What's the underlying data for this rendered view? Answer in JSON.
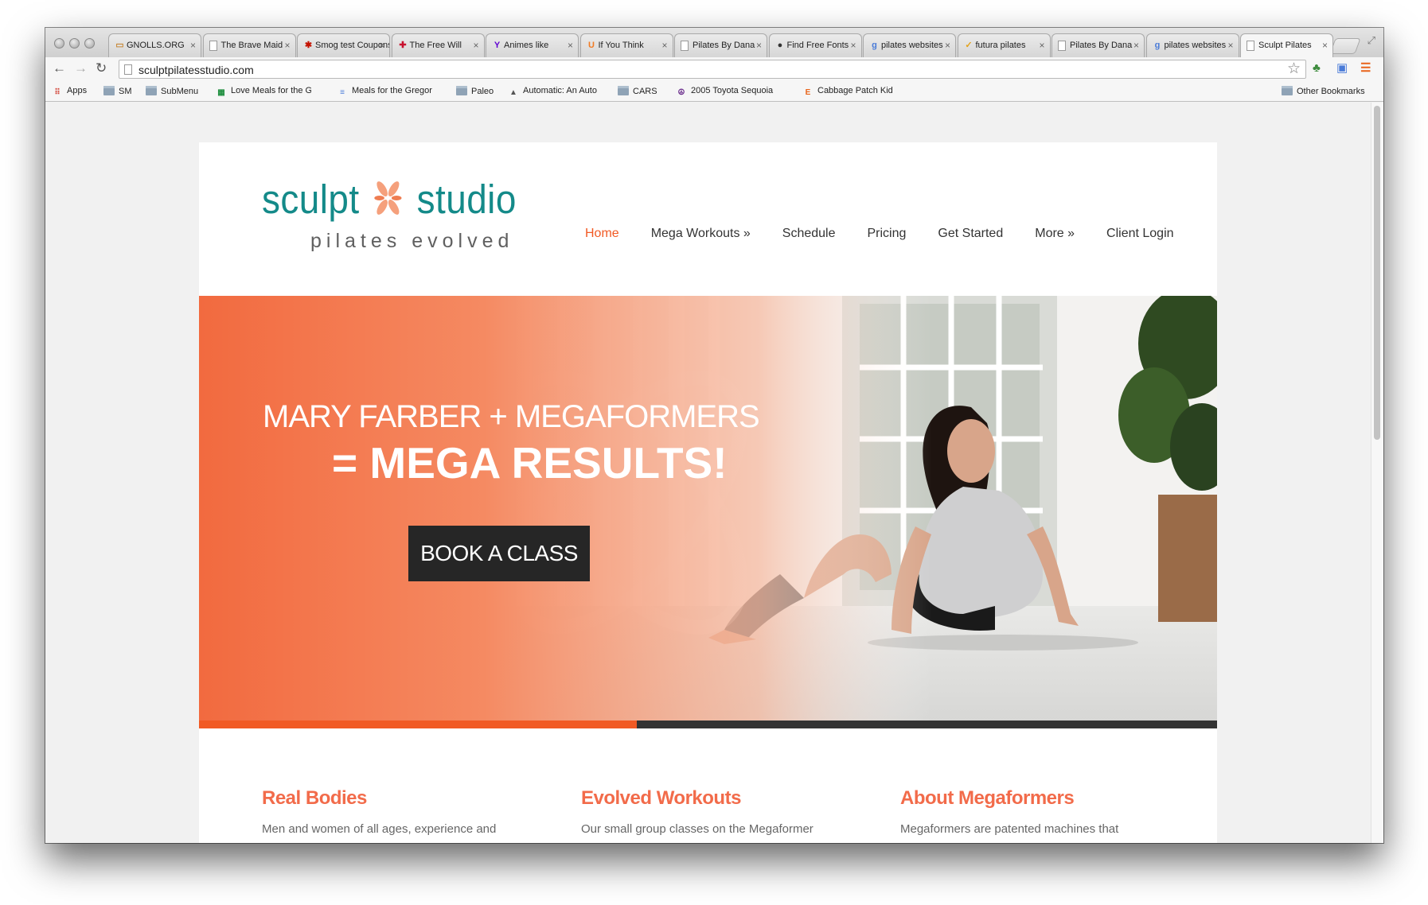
{
  "browser": {
    "tabs": [
      {
        "title": "GNOLLS.ORG",
        "icon": "gnolls-icon",
        "color": "#c78a3b"
      },
      {
        "title": "The Brave Maid",
        "icon": "page-icon",
        "color": "#888888"
      },
      {
        "title": "Smog test Coupons",
        "icon": "yelp-icon",
        "color": "#c41200"
      },
      {
        "title": "The Free Will",
        "icon": "flag-icon",
        "color": "#c8102e"
      },
      {
        "title": "Animes like",
        "icon": "yahoo-icon",
        "color": "#5f01d1"
      },
      {
        "title": "If You Think",
        "icon": "up-icon",
        "color": "#f27a22"
      },
      {
        "title": "Pilates By Dana",
        "icon": "page-icon",
        "color": "#888888"
      },
      {
        "title": "Find Free Fonts",
        "icon": "font-icon",
        "color": "#333333"
      },
      {
        "title": "pilates websites",
        "icon": "google-icon",
        "color": "#4a7bd8"
      },
      {
        "title": "futura pilates",
        "icon": "check-icon",
        "color": "#e3a21a"
      },
      {
        "title": "Pilates By Dana",
        "icon": "page-icon",
        "color": "#888888"
      },
      {
        "title": "pilates websites",
        "icon": "google-icon",
        "color": "#4a7bd8"
      },
      {
        "title": "Sculpt Pilates",
        "icon": "page-icon",
        "color": "#888888"
      }
    ],
    "url": "sculptpilatesstudio.com",
    "bookmarks": [
      {
        "label": "Apps",
        "icon": "apps-grid-icon"
      },
      {
        "label": "SM",
        "icon": "folder-icon"
      },
      {
        "label": "SubMenu",
        "icon": "folder-icon"
      },
      {
        "label": "Love Meals for the Gregory",
        "icon": "sheets-icon"
      },
      {
        "label": "Meals for the Gregory",
        "icon": "docs-icon"
      },
      {
        "label": "Paleo",
        "icon": "folder-icon"
      },
      {
        "label": "Automatic: An Auto",
        "icon": "automatic-icon"
      },
      {
        "label": "CARS",
        "icon": "folder-icon"
      },
      {
        "label": "2005 Toyota Sequoia",
        "icon": "peace-icon"
      },
      {
        "label": "Cabbage Patch Kid",
        "icon": "etsy-icon"
      }
    ],
    "other_bookmarks": "Other Bookmarks"
  },
  "site": {
    "logo": {
      "left": "sculpt",
      "right": "studio",
      "tagline": "pilates evolved"
    },
    "nav": [
      "Home",
      "Mega Workouts »",
      "Schedule",
      "Pricing",
      "Get Started",
      "More »",
      "Client Login"
    ],
    "hero": {
      "line1": "MARY FARBER + MEGAFORMERS",
      "line2": "= MEGA RESULTS!",
      "cta": "BOOK A CLASS",
      "slider_progress": 0.43
    },
    "features": [
      {
        "title": "Real Bodies",
        "text": "Men and women of all ages, experience and"
      },
      {
        "title": "Evolved Workouts",
        "text": "Our small group classes on the Megaformer"
      },
      {
        "title": "About Megaformers",
        "text": "Megaformers are patented machines that"
      }
    ]
  },
  "colors": {
    "brand_teal": "#148a89",
    "accent_orange": "#f15a24",
    "feature_title": "#f26b4a"
  }
}
